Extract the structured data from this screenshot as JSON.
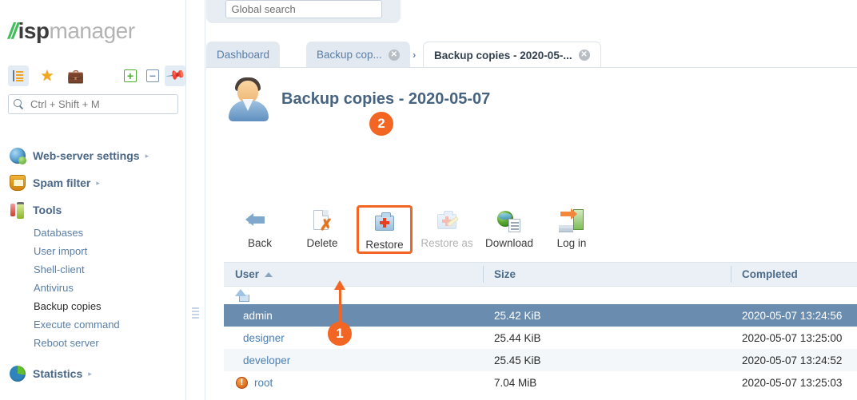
{
  "brand": {
    "slashes": "//",
    "name_bold": "isp",
    "name_light": "manager"
  },
  "sidebar": {
    "icon_strip": [
      {
        "name": "tree-view-icon",
        "label": "Tree view",
        "active": true
      },
      {
        "name": "favorites-star-icon",
        "label": "Favorites",
        "active": false
      },
      {
        "name": "clipboard-icon",
        "label": "Clipboard",
        "active": false
      },
      {
        "name": "expand-all-icon",
        "label": "+",
        "active": false
      },
      {
        "name": "collapse-all-icon",
        "label": "−",
        "active": false
      },
      {
        "name": "pin-icon",
        "label": "Pin menu",
        "active": true
      }
    ],
    "search": {
      "placeholder": "Ctrl + Shift + M",
      "value": ""
    },
    "sections": [
      {
        "label": "Web-server settings",
        "icon": "globe-icon",
        "chevron": "▸",
        "items": []
      },
      {
        "label": "Spam filter",
        "icon": "shield-icon",
        "chevron": "▸",
        "items": []
      },
      {
        "label": "Tools",
        "icon": "tools-icon",
        "chevron": "",
        "items": [
          {
            "label": "Databases",
            "current": false
          },
          {
            "label": "User import",
            "current": false
          },
          {
            "label": "Shell-client",
            "current": false
          },
          {
            "label": "Antivirus",
            "current": false
          },
          {
            "label": "Backup copies",
            "current": true
          },
          {
            "label": "Execute command",
            "current": false
          },
          {
            "label": "Reboot server",
            "current": false
          }
        ]
      },
      {
        "label": "Statistics",
        "icon": "pie-chart-icon",
        "chevron": "▸",
        "items": []
      }
    ]
  },
  "global_search": {
    "placeholder": "Global search",
    "value": ""
  },
  "tabs": [
    {
      "label": "Dashboard",
      "active": false,
      "closable": false
    },
    {
      "label": "Backup cop...",
      "active": false,
      "closable": true
    },
    {
      "label": "Backup copies - 2020-05-...",
      "active": true,
      "closable": true
    }
  ],
  "tab_separator": "›",
  "tab_close_glyph": "✕",
  "page": {
    "title": "Backup copies - 2020-05-07",
    "avatar_name": "user-avatar"
  },
  "toolbar": [
    {
      "label": "Back",
      "icon": "back-arrow-icon",
      "enabled": true,
      "highlighted": false
    },
    {
      "label": "Delete",
      "icon": "delete-icon",
      "enabled": true,
      "highlighted": false
    },
    {
      "label": "Restore",
      "icon": "restore-icon",
      "enabled": true,
      "highlighted": true
    },
    {
      "label": "Restore as",
      "icon": "restore-as-icon",
      "enabled": false,
      "highlighted": false
    },
    {
      "label": "Download",
      "icon": "download-icon",
      "enabled": true,
      "highlighted": false
    },
    {
      "label": "Log in",
      "icon": "log-in-icon",
      "enabled": true,
      "highlighted": false
    }
  ],
  "table": {
    "columns": [
      {
        "key": "user",
        "label": "User",
        "sorted": true,
        "sort_dir": "asc"
      },
      {
        "key": "size",
        "label": "Size",
        "sorted": false,
        "sort_dir": ""
      },
      {
        "key": "completed",
        "label": "Completed",
        "sorted": false,
        "sort_dir": ""
      }
    ],
    "parent_row": {
      "name": "go-up-row",
      "icon": "up-folder-icon"
    },
    "rows": [
      {
        "user": "admin",
        "size": "25.42 KiB",
        "completed": "2020-05-07 13:24:56",
        "selected": true,
        "warning": false
      },
      {
        "user": "designer",
        "size": "25.44 KiB",
        "completed": "2020-05-07 13:25:00",
        "selected": false,
        "warning": false
      },
      {
        "user": "developer",
        "size": "25.45 KiB",
        "completed": "2020-05-07 13:24:52",
        "selected": false,
        "warning": false
      },
      {
        "user": "root",
        "size": "7.04 MiB",
        "completed": "2020-05-07 13:25:03",
        "selected": false,
        "warning": true
      }
    ]
  },
  "annotations": [
    {
      "id": "1",
      "label": "1",
      "target": "table-row-developer"
    },
    {
      "id": "2",
      "label": "2",
      "target": "toolbar-restore-button"
    }
  ],
  "colors": {
    "accent_orange": "#f26522",
    "selected_row": "#6a8cae",
    "header_bg": "#eaf0f6",
    "link_blue": "#4a7fb5",
    "heading_blue": "#46637f",
    "brand_green": "#3fbf5a"
  }
}
